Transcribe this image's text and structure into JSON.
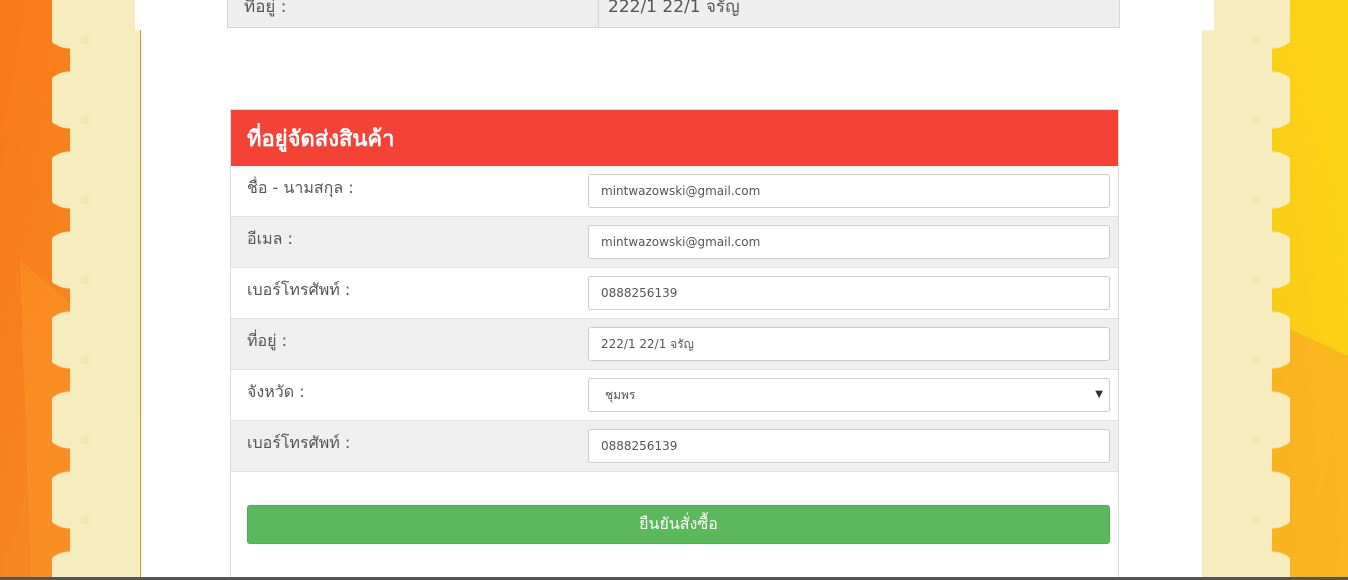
{
  "colors": {
    "header": "#f44336",
    "submit": "#5cb85c",
    "row_alt": "#efefef",
    "background_left": "#f47a1f",
    "background_right": "#fad60f",
    "scallop": "#f7ecbd"
  },
  "previous_section": {
    "label": "ที่อยู่ :",
    "value": "222/1 22/1 จรัญ"
  },
  "shipping": {
    "title": "ที่อยู่จัดส่งสินค้า",
    "fields": [
      {
        "label": "ชื่อ - นามสกุล :",
        "value": "mintwazowski@gmail.com"
      },
      {
        "label": "อีเมล :",
        "value": "mintwazowski@gmail.com"
      },
      {
        "label": "เบอร์โทรศัพท์ :",
        "value": "0888256139"
      },
      {
        "label": "ที่อยู่ :",
        "value": "222/1 22/1 จรัญ"
      },
      {
        "label": "จังหวัด :",
        "value": "ชุมพร",
        "type": "select"
      },
      {
        "label": "เบอร์โทรศัพท์ :",
        "value": "0888256139"
      }
    ],
    "submit_label": "ยืนยันสั่งซื้อ"
  },
  "icons": {
    "select_caret": "caret-down-icon"
  }
}
